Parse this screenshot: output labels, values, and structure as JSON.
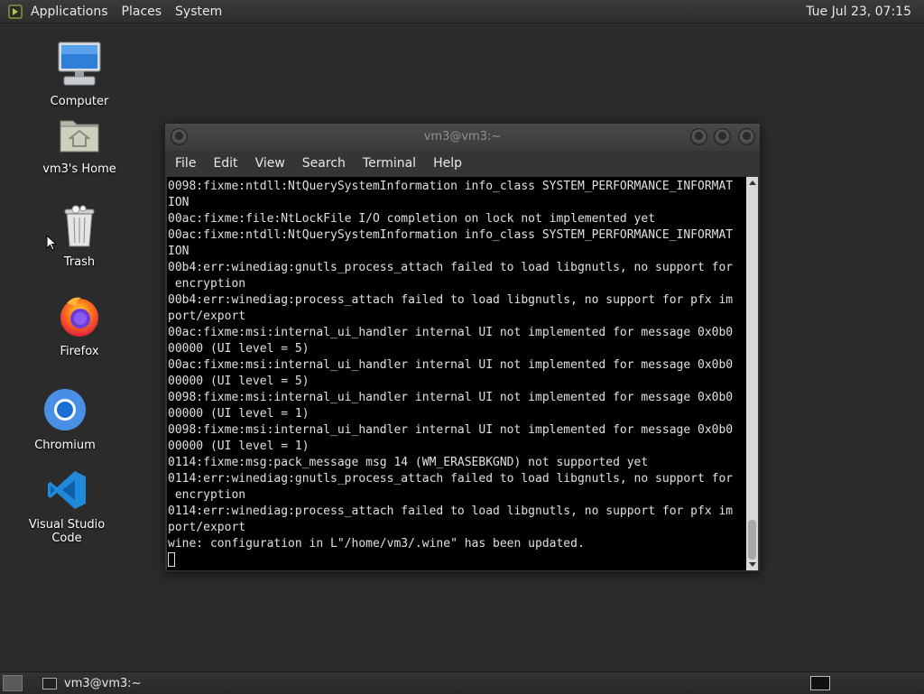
{
  "top_panel": {
    "menus": [
      "Applications",
      "Places",
      "System"
    ],
    "clock": "Tue Jul 23, 07:15"
  },
  "desktop": {
    "icons": [
      {
        "label": "Computer",
        "icon": "computer-icon"
      },
      {
        "label": "vm3's Home",
        "icon": "home-folder-icon"
      },
      {
        "label": "Trash",
        "icon": "trash-icon"
      },
      {
        "label": "Firefox",
        "icon": "firefox-icon"
      },
      {
        "label": "Chromium",
        "icon": "chromium-icon"
      },
      {
        "label": "Visual Studio Code",
        "icon": "vscode-icon"
      }
    ]
  },
  "terminal": {
    "title": "vm3@vm3:~",
    "menu": [
      "File",
      "Edit",
      "View",
      "Search",
      "Terminal",
      "Help"
    ],
    "lines": [
      "0098:fixme:ntdll:NtQuerySystemInformation info_class SYSTEM_PERFORMANCE_INFORMAT",
      "ION",
      "00ac:fixme:file:NtLockFile I/O completion on lock not implemented yet",
      "00ac:fixme:ntdll:NtQuerySystemInformation info_class SYSTEM_PERFORMANCE_INFORMAT",
      "ION",
      "00b4:err:winediag:gnutls_process_attach failed to load libgnutls, no support for",
      " encryption",
      "00b4:err:winediag:process_attach failed to load libgnutls, no support for pfx im",
      "port/export",
      "00ac:fixme:msi:internal_ui_handler internal UI not implemented for message 0x0b0",
      "00000 (UI level = 5)",
      "00ac:fixme:msi:internal_ui_handler internal UI not implemented for message 0x0b0",
      "00000 (UI level = 5)",
      "0098:fixme:msi:internal_ui_handler internal UI not implemented for message 0x0b0",
      "00000 (UI level = 1)",
      "0098:fixme:msi:internal_ui_handler internal UI not implemented for message 0x0b0",
      "00000 (UI level = 1)",
      "0114:fixme:msg:pack_message msg 14 (WM_ERASEBKGND) not supported yet",
      "0114:err:winediag:gnutls_process_attach failed to load libgnutls, no support for",
      " encryption",
      "0114:err:winediag:process_attach failed to load libgnutls, no support for pfx im",
      "port/export",
      "wine: configuration in L\"/home/vm3/.wine\" has been updated."
    ]
  },
  "taskbar": {
    "task_label": "vm3@vm3:~"
  }
}
